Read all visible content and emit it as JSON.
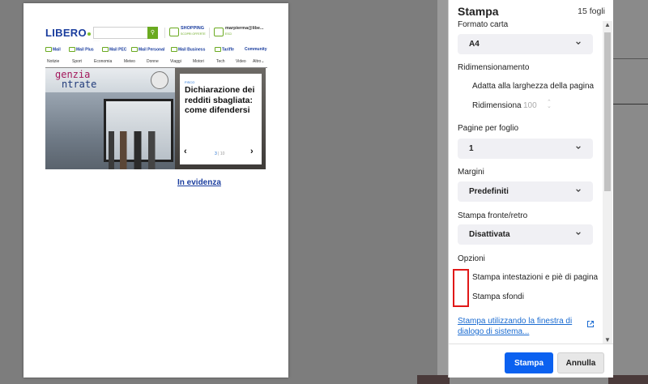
{
  "preview": {
    "logo": "LIBERO",
    "shopping": {
      "title": "SHOPPING",
      "subtitle": "SCOPRI OFFERTE"
    },
    "account": {
      "email": "marpierma@libe...",
      "sub": "ESCI"
    },
    "services": [
      "Mail",
      "Mail Plus",
      "Mail PEC",
      "Mail Personal",
      "Mail Business",
      "Tariffe",
      "Community"
    ],
    "nav": [
      "Notizie",
      "Sport",
      "Economia",
      "Meteo",
      "Donne",
      "Viaggi",
      "Motori",
      "Tech",
      "Video",
      "Altro⌄"
    ],
    "hero": {
      "sign_line1": "genzia",
      "sign_line2": "ntrate",
      "category": "FISCO",
      "title": "Dichiarazione dei redditi sbagliata: come difendersi",
      "prev": "‹",
      "next": "›",
      "page": "3",
      "total": "| 10"
    },
    "in_evidenza": "In evidenza"
  },
  "dialog": {
    "title": "Stampa",
    "sheets": "15 fogli",
    "format_label": "Formato carta",
    "format_value": "A4",
    "resize_label": "Ridimensionamento",
    "resize_fit": "Adatta alla larghezza della pagina",
    "resize_custom": "Ridimensiona",
    "resize_value": "100",
    "pages_per_sheet_label": "Pagine per foglio",
    "pages_per_sheet_value": "1",
    "margins_label": "Margini",
    "margins_value": "Predefiniti",
    "duplex_label": "Stampa fronte/retro",
    "duplex_value": "Disattivata",
    "options_label": "Opzioni",
    "opt_headers": "Stampa intestazioni e piè di pagina",
    "opt_backgrounds": "Stampa sfondi",
    "system_dialog_link": "Stampa utilizzando la finestra di dialogo di sistema...",
    "print_button": "Stampa",
    "cancel_button": "Annulla"
  },
  "colors": {
    "accent": "#0b61f0",
    "highlight": "#e01818",
    "brand": "#1a3d9e",
    "brand_green": "#6aaa20"
  }
}
